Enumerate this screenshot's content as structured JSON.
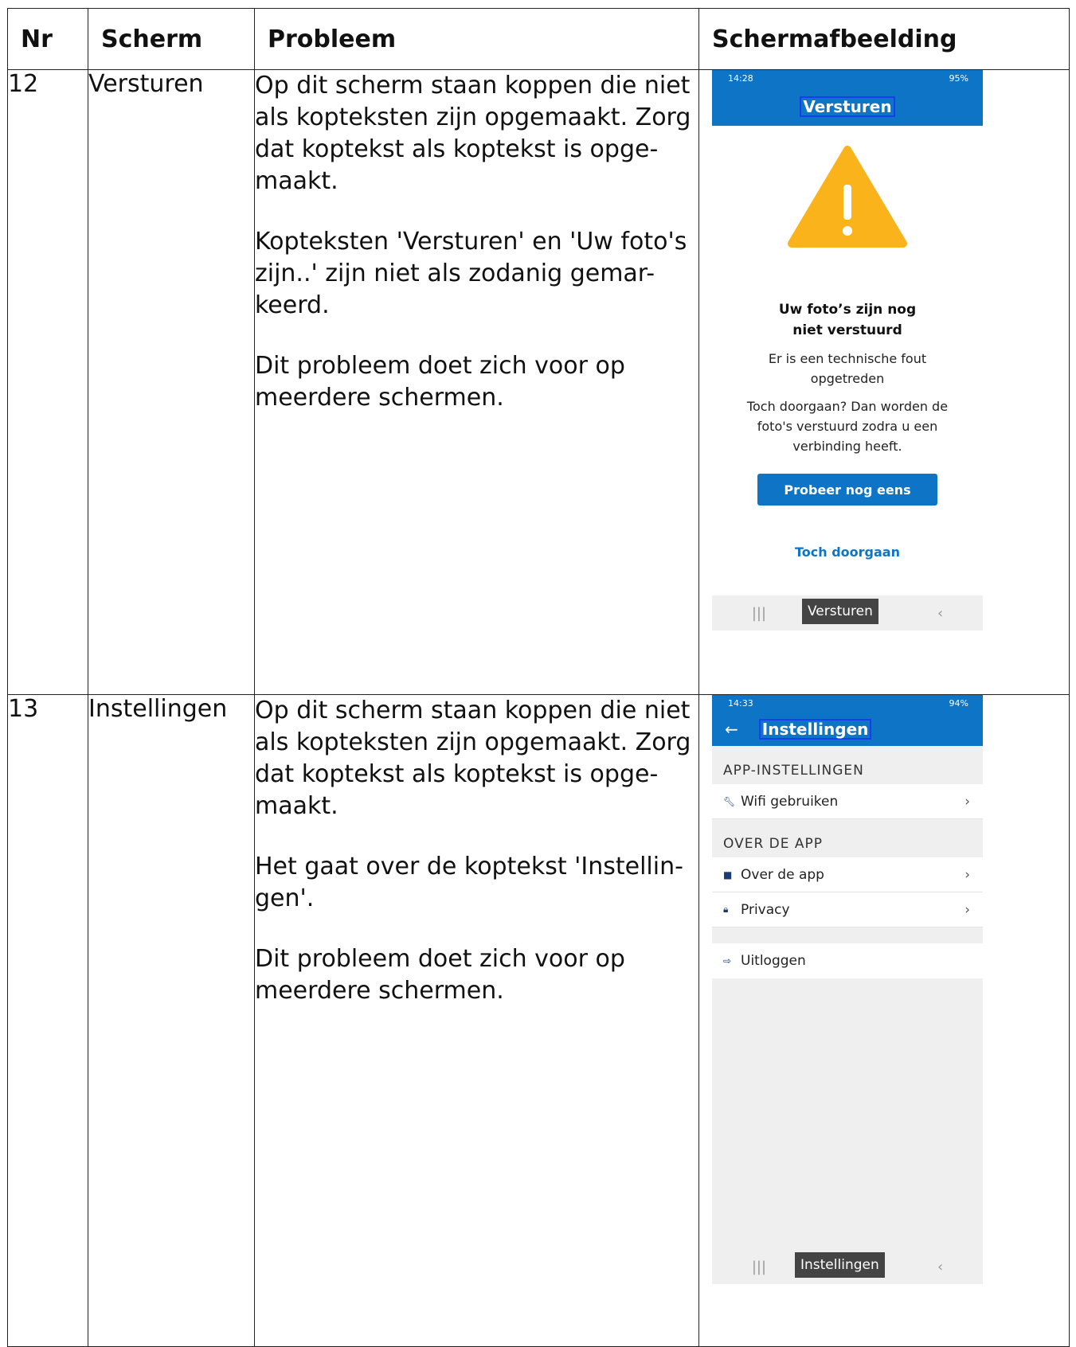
{
  "table": {
    "headers": [
      "Nr",
      "Scherm",
      "Probleem",
      "Schermafbeelding"
    ],
    "rows": [
      {
        "nr": "12",
        "scherm": "Versturen",
        "probleem": [
          "Op dit scherm staan koppen die niet als kopteksten zijn opgemaakt. Zorg dat koptekst als koptekst is opge-maakt.",
          "Kopteksten 'Versturen' en 'Uw foto's zijn..' zijn niet als zodanig gemar-keerd.",
          "Dit probleem doet zich voor op meerdere schermen."
        ],
        "screenshot": {
          "status_time": "14:28",
          "status_right": "95%",
          "app_title": "Versturen",
          "warning_icon": "warning-triangle-icon",
          "message_title": "Uw foto’s zijn nog niet verstuurd",
          "message_1": "Er is een technische fout opgetreden",
          "message_2": "Toch doorgaan? Dan worden de foto's verstuurd zodra u een verbinding heeft.",
          "primary_button": "Probeer nog eens",
          "secondary_button": "Toch doorgaan",
          "tooltip": "Versturen",
          "accent_color": "#0d74c6",
          "warning_color": "#fbb31c"
        }
      },
      {
        "nr": "13",
        "scherm": "Instellingen",
        "probleem": [
          "Op dit scherm staan koppen die niet als kopteksten zijn opgemaakt. Zorg dat koptekst als koptekst is opge-maakt.",
          "Het gaat over de koptekst 'Instellin-gen'.",
          "Dit probleem doet zich voor op meerdere schermen."
        ],
        "screenshot": {
          "status_time": "14:33",
          "status_right": "94%",
          "back_icon": "←",
          "app_title": "Instellingen",
          "section_1": "APP-INSTELLINGEN",
          "item_wifi": "Wifi gebruiken",
          "section_2": "OVER DE APP",
          "item_about": "Over de app",
          "item_privacy": "Privacy",
          "item_logout": "Uitloggen",
          "tooltip": "Instellingen"
        }
      }
    ]
  }
}
